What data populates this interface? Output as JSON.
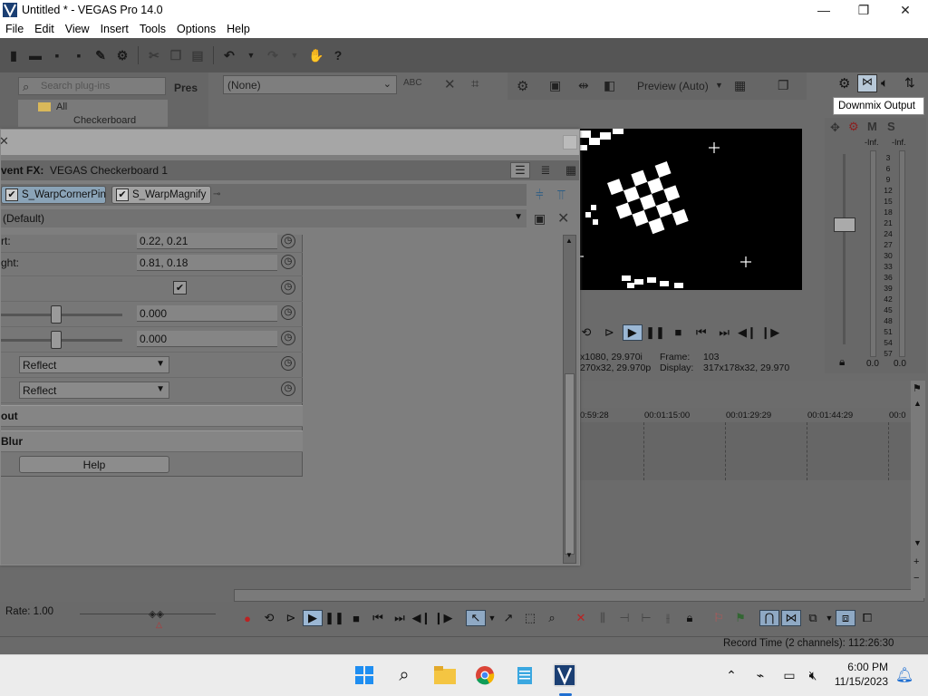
{
  "window": {
    "title": "Untitled * - VEGAS Pro 14.0",
    "min_label": "—",
    "max_label": "❐",
    "close_label": "✕"
  },
  "menu": [
    "File",
    "Edit",
    "View",
    "Insert",
    "Tools",
    "Options",
    "Help"
  ],
  "plugin_chooser": {
    "search_placeholder": "Search plug-ins",
    "presets_label": "Pres",
    "tree_all": "All",
    "tree_checkerboard": "Checkerboard"
  },
  "fx_selector": {
    "value": "(None)"
  },
  "preview": {
    "quality_label": "Preview (Auto)",
    "info_line1_left": "x1080, 29.970i",
    "info_line1_right_label": "Frame:",
    "info_line1_right_value": "103",
    "info_line2_left": "270x32, 29.970p",
    "info_line2_right_label": "Display:",
    "info_line2_right_value": "317x178x32, 29.970"
  },
  "mixer": {
    "tooltip": "Downmix Output",
    "m_label": "M",
    "s_label": "S",
    "inf_left": "-Inf.",
    "inf_right": "-Inf.",
    "scale": [
      "3",
      "6",
      "9",
      "12",
      "15",
      "18",
      "21",
      "24",
      "27",
      "30",
      "33",
      "36",
      "39",
      "42",
      "45",
      "48",
      "51",
      "54",
      "57"
    ],
    "val_left": "0.0",
    "val_right": "0.0"
  },
  "timeline": {
    "ruler": [
      "0:59:28",
      "00:01:15:00",
      "00:01:29:29",
      "00:01:44:29",
      "00:0"
    ]
  },
  "event_fx": {
    "header_label": "vent FX:",
    "header_value": "VEGAS Checkerboard 1",
    "chain": [
      "S_WarpCornerPin",
      "S_WarpMagnify"
    ],
    "preset": "(Default)",
    "params": [
      {
        "label": "rt:",
        "value": "0.22, 0.21"
      },
      {
        "label": "ght:",
        "value": "0.81, 0.18"
      },
      {
        "label": "",
        "value": "0.000"
      },
      {
        "label": "",
        "value": "0.000"
      }
    ],
    "dropdown1": "Reflect",
    "dropdown2": "Reflect",
    "section1": "out",
    "section2": "Blur",
    "help": "Help"
  },
  "bottom": {
    "rate": "Rate: 1.00",
    "record_time": "Record Time (2 channels): 112:26:30"
  },
  "taskbar": {
    "time": "6:00 PM",
    "date": "11/15/2023"
  }
}
